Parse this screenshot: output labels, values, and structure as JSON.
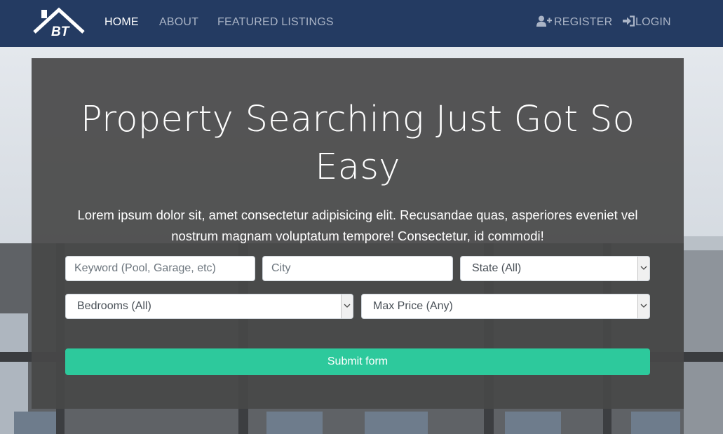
{
  "nav": {
    "brand": "BT",
    "links": [
      {
        "label": "HOME",
        "active": true
      },
      {
        "label": "ABOUT",
        "active": false
      },
      {
        "label": "FEATURED LISTINGS",
        "active": false
      }
    ],
    "register": "REGISTER",
    "login": "LOGIN"
  },
  "hero": {
    "title_line1": "Property Searching Just Got So",
    "title_line2": "Easy",
    "lead": "Lorem ipsum dolor sit, amet consectetur adipisicing elit. Recusandae quas, asperiores eveniet vel nostrum magnam voluptatum tempore! Consectetur, id commodi!"
  },
  "form": {
    "keyword_placeholder": "Keyword (Pool, Garage, etc)",
    "city_placeholder": "City",
    "state_value": "State (All)",
    "bedrooms_value": "Bedrooms (All)",
    "price_value": "Max Price (Any)",
    "submit_label": "Submit form"
  },
  "colors": {
    "navbar": "#243b62",
    "accent": "#2dc99c",
    "overlay": "#484848"
  }
}
